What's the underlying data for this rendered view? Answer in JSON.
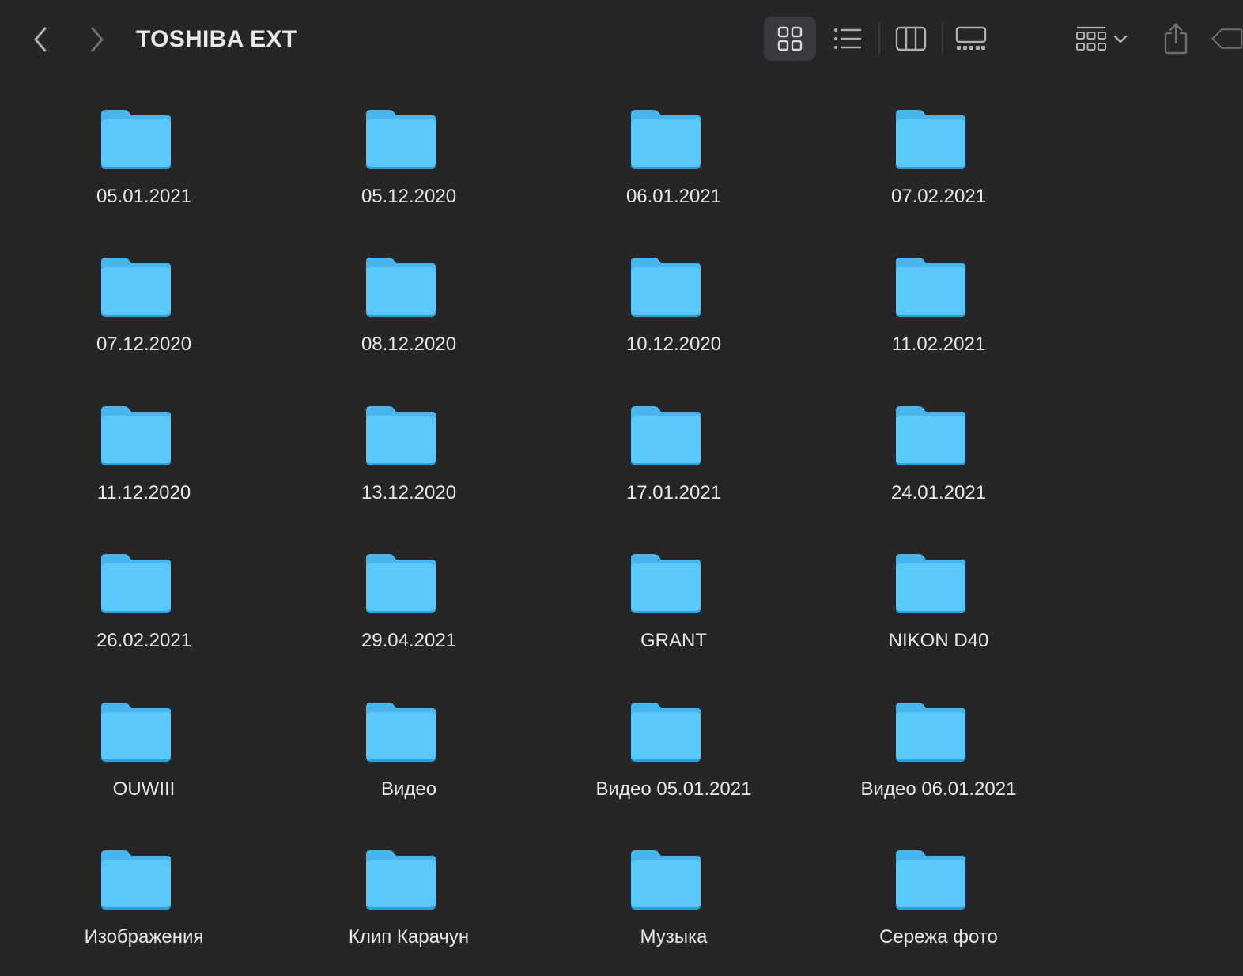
{
  "window": {
    "title": "TOSHIBA EXT"
  },
  "toolbar": {
    "back_icon": "chevron-left-icon",
    "forward_icon": "chevron-right-icon",
    "views": [
      {
        "name": "icon-view",
        "active": true
      },
      {
        "name": "list-view",
        "active": false
      },
      {
        "name": "column-view",
        "active": false
      },
      {
        "name": "gallery-view",
        "active": false
      }
    ],
    "group_icon": "group-grid-icon",
    "share_icon": "share-icon",
    "tag_icon": "tag-icon"
  },
  "colors": {
    "background": "#262626",
    "folder_body": "#5ac8fa",
    "folder_tab": "#48b5ec",
    "folder_shadow": "#2f9fdb",
    "icon_gray": "#b0b0b0",
    "icon_dim": "#6e6e6e"
  },
  "folders": [
    {
      "label": "05.01.2021"
    },
    {
      "label": "05.12.2020"
    },
    {
      "label": "06.01.2021"
    },
    {
      "label": "07.02.2021"
    },
    {
      "label": "07.12.2020"
    },
    {
      "label": "08.12.2020"
    },
    {
      "label": "10.12.2020"
    },
    {
      "label": "11.02.2021"
    },
    {
      "label": "11.12.2020"
    },
    {
      "label": "13.12.2020"
    },
    {
      "label": "17.01.2021"
    },
    {
      "label": "24.01.2021"
    },
    {
      "label": "26.02.2021"
    },
    {
      "label": "29.04.2021"
    },
    {
      "label": "GRANT"
    },
    {
      "label": "NIKON D40"
    },
    {
      "label": "OUWIII"
    },
    {
      "label": "Видео"
    },
    {
      "label": "Видео 05.01.2021"
    },
    {
      "label": "Видео 06.01.2021"
    },
    {
      "label": "Изображения"
    },
    {
      "label": "Клип Карачун"
    },
    {
      "label": "Музыка"
    },
    {
      "label": "Сережа фото"
    }
  ]
}
